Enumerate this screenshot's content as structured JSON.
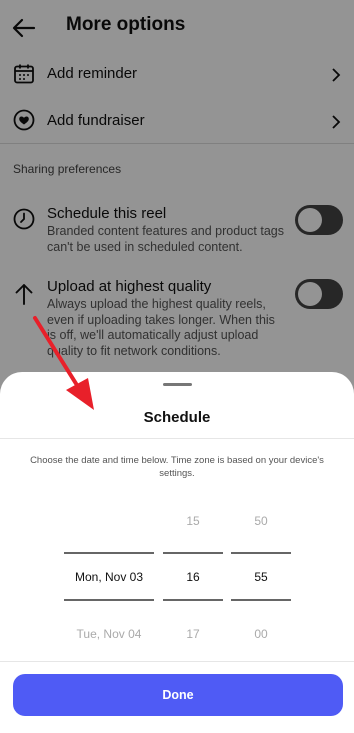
{
  "header": {
    "title": "More options"
  },
  "menu": [
    {
      "label": "Add reminder",
      "icon": "calendar-icon"
    },
    {
      "label": "Add fundraiser",
      "icon": "fundraiser-icon"
    }
  ],
  "sharing": {
    "section_title": "Sharing preferences",
    "options": [
      {
        "title": "Schedule this reel",
        "description": "Branded content features and product tags can't be used in scheduled content.",
        "icon": "clock-icon",
        "enabled": false
      },
      {
        "title": "Upload at highest quality",
        "description": "Always upload the highest quality reels, even if uploading takes longer. When this is off, we'll automatically adjust upload quality to fit network conditions.",
        "icon": "arrow-up-icon",
        "enabled": false
      }
    ]
  },
  "sheet": {
    "title": "Schedule",
    "description": "Choose the date and time below. Time zone is based on your device's settings.",
    "picker": {
      "date": {
        "previous": "",
        "selected": "Mon, Nov 03",
        "next": "Tue, Nov 04"
      },
      "hour": {
        "previous": "15",
        "selected": "16",
        "next": "17"
      },
      "minute": {
        "previous": "50",
        "selected": "55",
        "next": "00"
      }
    },
    "done_label": "Done"
  },
  "colors": {
    "accent": "#4f5bf5",
    "annotation_arrow": "#e8202a"
  }
}
